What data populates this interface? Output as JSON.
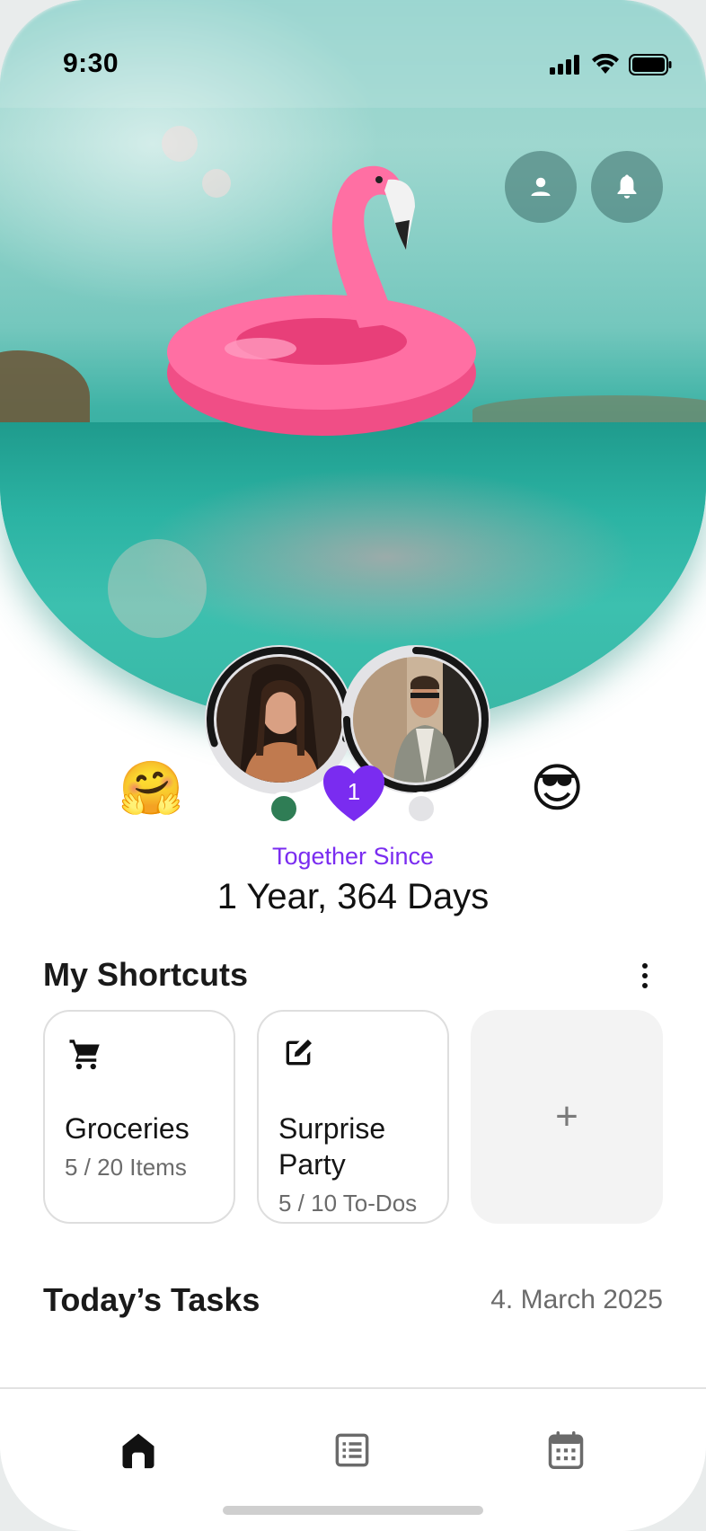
{
  "status_bar": {
    "time": "9:30",
    "icons": [
      "signal-icon",
      "wifi-icon",
      "battery-icon"
    ]
  },
  "hero": {
    "buttons": [
      {
        "icon": "person-icon"
      },
      {
        "icon": "bell-icon"
      }
    ]
  },
  "couple": {
    "heart_count": "1",
    "emoji_left": "🤗",
    "emoji_right": "😎",
    "partner_left_status_color": "#2f7d55",
    "partner_right_status_color": "#e3e3e6",
    "partner_left_progress": 0.6,
    "partner_right_progress": 0.75,
    "together_label": "Together Since",
    "together_value": "1 Year, 364 Days"
  },
  "shortcuts": {
    "title": "My Shortcuts",
    "items": [
      {
        "icon": "cart-icon",
        "title": "Groceries",
        "subtitle": "5 / 20 Items"
      },
      {
        "icon": "edit-icon",
        "title": "Surprise Party",
        "subtitle": "5 / 10 To-Dos"
      }
    ],
    "add_label": "+"
  },
  "tasks": {
    "title": "Today’s Tasks",
    "date": "4. March 2025"
  },
  "tabbar": {
    "items": [
      {
        "icon": "home-icon"
      },
      {
        "icon": "list-icon"
      },
      {
        "icon": "calendar-icon"
      }
    ]
  },
  "colors": {
    "accent": "#7a2cf0",
    "text": "#111111",
    "muted": "#6b6b6b",
    "card_border": "#dedede"
  }
}
